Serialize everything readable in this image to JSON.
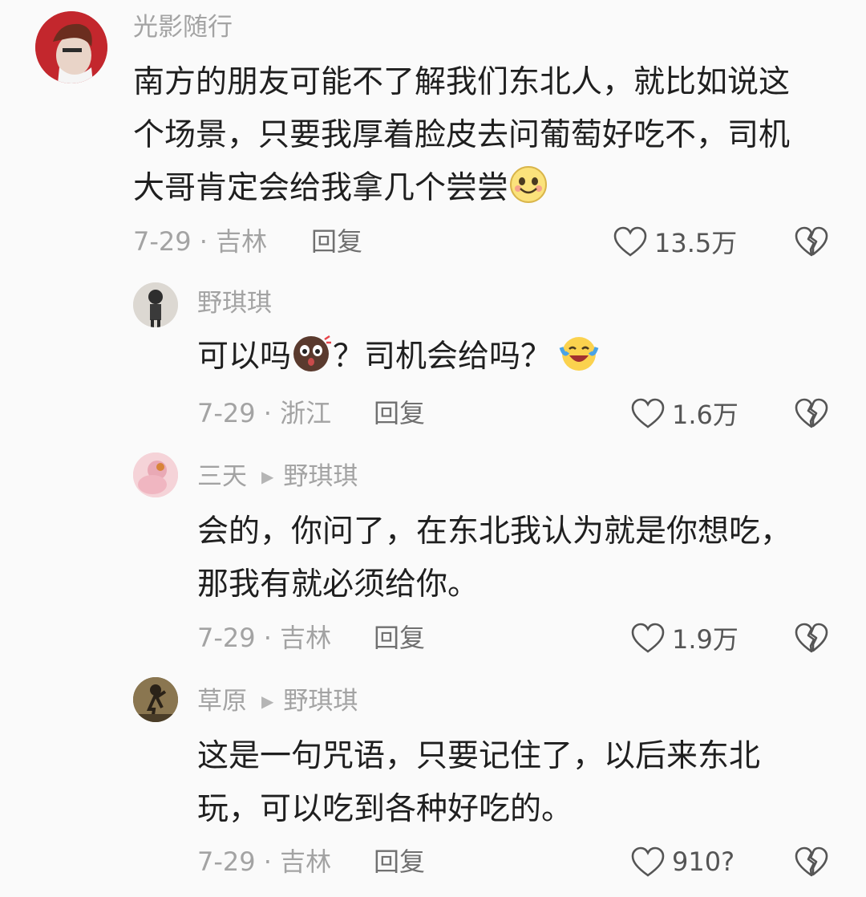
{
  "comments": [
    {
      "user": "光影随行",
      "text_lines": [
        "南方的朋友可能不了解我们东北人，就比如说这",
        "个场景，只要我厚着脸皮去问葡萄好吃不，司机",
        "大哥肯定会给我拿几个尝尝"
      ],
      "emoji": "smile-emoji",
      "date_location": "7-29 · 吉林",
      "reply_label": "回复",
      "likes": "13.5万"
    },
    {
      "user": "野琪琪",
      "text_part1": "可以吗",
      "text_part2": "？司机会给吗？",
      "emojis": [
        "surprised-emoji",
        "laughing-crying-emoji"
      ],
      "date_location": "7-29 · 浙江",
      "reply_label": "回复",
      "likes": "1.6万"
    },
    {
      "user": "三天",
      "reply_to": "野琪琪",
      "text_lines": [
        "会的，你问了，在东北我认为就是你想吃，",
        "那我有就必须给你。"
      ],
      "date_location": "7-29 · 吉林",
      "reply_label": "回复",
      "likes": "1.9万"
    },
    {
      "user": "草原",
      "reply_to": "野琪琪",
      "text_lines": [
        "这是一句咒语，只要记住了，以后来东北",
        "玩，可以吃到各种好吃的。"
      ],
      "date_location": "7-29 · 吉林",
      "reply_label": "回复",
      "likes": "910?"
    }
  ],
  "colors": {
    "username": "#a3a3a3",
    "text": "#1f1f1f",
    "meta": "#a3a3a3",
    "avatar1": "#c0282e"
  }
}
